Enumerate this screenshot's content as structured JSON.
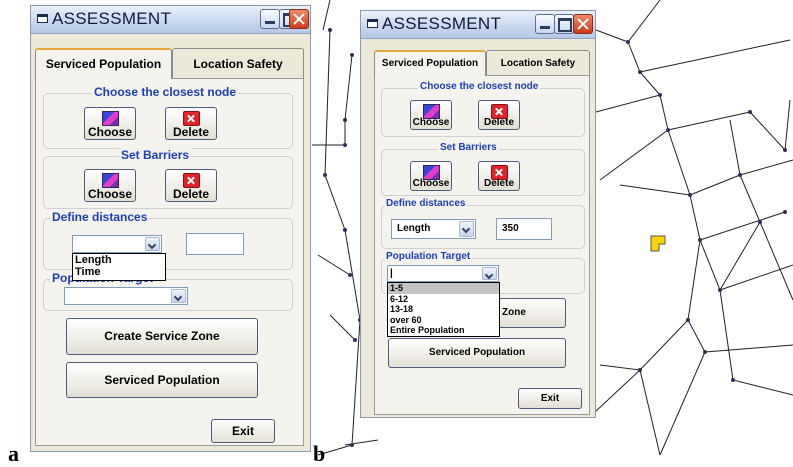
{
  "labels": {
    "left": "a",
    "right": "b"
  },
  "left": {
    "title": "ASSESSMENT",
    "tabs": [
      "Serviced  Population",
      "Location Safety"
    ],
    "closest_node": {
      "title": "Choose the closest node",
      "choose": "Choose",
      "delete": "Delete"
    },
    "barriers": {
      "title": "Set Barriers",
      "choose": "Choose",
      "delete": "Delete"
    },
    "distances": {
      "title": "Define distances",
      "value": "",
      "input": "",
      "options": [
        "Length",
        "Time"
      ]
    },
    "population": {
      "title": "Population Target",
      "value": ""
    },
    "create_zone": "Create Service Zone",
    "serviced_population": "Serviced Population",
    "exit": "Exit"
  },
  "right": {
    "title": "ASSESSMENT",
    "tabs": [
      "Serviced  Population",
      "Location Safety"
    ],
    "closest_node": {
      "title": "Choose the closest node",
      "choose": "Choose",
      "delete": "Delete"
    },
    "barriers": {
      "title": "Set Barriers",
      "choose": "Choose",
      "delete": "Delete"
    },
    "distances": {
      "title": "Define distances",
      "value": "Length",
      "input": "350"
    },
    "population": {
      "title": "Population Target",
      "value": "|",
      "options": [
        "1-5",
        "6-12",
        "13-18",
        "over 60",
        "Entire Population"
      ],
      "selected": 0
    },
    "create_zone_visible": "Zone",
    "serviced_population": "Serviced Population",
    "exit": "Exit"
  },
  "icons": {
    "choose": "node-picker-icon",
    "delete": "delete-x-icon",
    "window": "window-icon"
  },
  "colors": {
    "group_title": "#1c3fb8",
    "tab_accent": "#e8a33a",
    "map_node": "#3a2a5a",
    "map_marker": "#ffd400"
  }
}
